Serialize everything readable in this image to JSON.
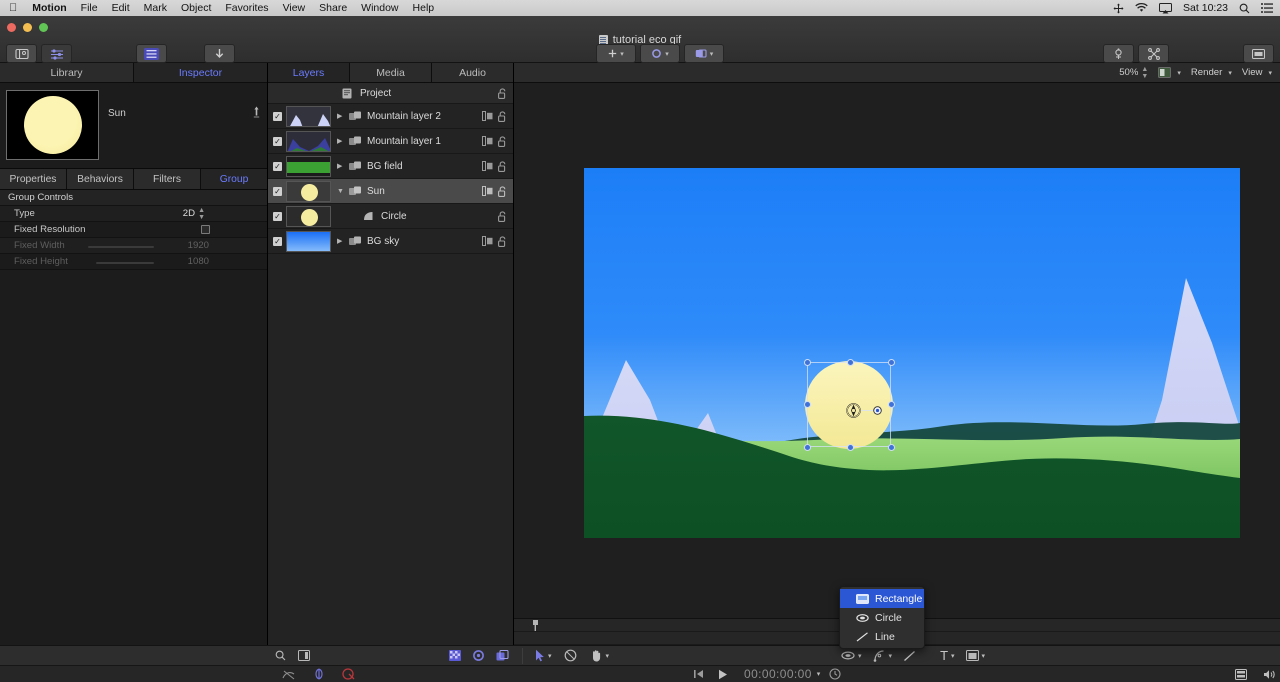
{
  "menubar": {
    "apple_icon": "apple-logo-icon",
    "items": [
      "Motion",
      "File",
      "Edit",
      "Mark",
      "Object",
      "Favorites",
      "View",
      "Share",
      "Window",
      "Help"
    ],
    "status_icons": [
      "move-icon",
      "wifi-icon",
      "airplay-icon"
    ],
    "clock": "Sat 10:23",
    "right_icons": [
      "search-icon",
      "control-center-icon"
    ]
  },
  "toolbar": {
    "document_title": "tutorial eco gif",
    "left_buttons": [
      {
        "label": "Library",
        "icon": "library-icon"
      },
      {
        "label": "Inspector",
        "icon": "inspector-sliders-icon"
      }
    ],
    "project_pane": {
      "label": "Project Pane",
      "icon": "project-pane-icon"
    },
    "import": {
      "label": "Import",
      "icon": "import-arrow-icon"
    },
    "center_buttons": [
      {
        "label": "Add Object",
        "icon": "plus-icon"
      },
      {
        "label": "Behaviors",
        "icon": "behaviors-gear-icon"
      },
      {
        "label": "Filters",
        "icon": "filters-icon"
      }
    ],
    "right_buttons": [
      {
        "label": "Make Particles",
        "icon": "particles-icon"
      },
      {
        "label": "Replicate",
        "icon": "replicate-icon"
      },
      {
        "label": "HUD",
        "icon": "hud-icon"
      }
    ]
  },
  "inspector": {
    "tabs": [
      {
        "label": "Library",
        "selected": false
      },
      {
        "label": "Inspector",
        "selected": true
      }
    ],
    "object_name": "Sun",
    "pin_icon": "pin-icon",
    "subtabs": [
      {
        "label": "Properties",
        "selected": false
      },
      {
        "label": "Behaviors",
        "selected": false
      },
      {
        "label": "Filters",
        "selected": false
      },
      {
        "label": "Group",
        "selected": true
      }
    ],
    "section_title": "Group Controls",
    "properties": [
      {
        "label": "Type",
        "value": "2D",
        "control": "stepper",
        "disabled": false
      },
      {
        "label": "Fixed Resolution",
        "value": "",
        "control": "checkbox",
        "disabled": false
      },
      {
        "label": "Fixed Width",
        "value": "1920",
        "control": "slider",
        "disabled": true
      },
      {
        "label": "Fixed Height",
        "value": "1080",
        "control": "slider",
        "disabled": true
      }
    ]
  },
  "layers": {
    "tabs": [
      {
        "label": "Layers",
        "selected": true
      },
      {
        "label": "Media",
        "selected": false
      },
      {
        "label": "Audio",
        "selected": false
      }
    ],
    "project_row": {
      "label": "Project",
      "icon": "document-icon",
      "lock_icon": "lock-open-icon"
    },
    "rows": [
      {
        "label": "Mountain layer 2",
        "checked": true,
        "type": "group",
        "expanded": false,
        "indent": 0,
        "thumb": "mountain2",
        "icons": [
          "dropzone-icon",
          "lock-open-icon"
        ]
      },
      {
        "label": "Mountain layer 1",
        "checked": true,
        "type": "group",
        "expanded": false,
        "indent": 0,
        "thumb": "mountain1",
        "icons": [
          "dropzone-icon",
          "lock-open-icon"
        ]
      },
      {
        "label": "BG field",
        "checked": true,
        "type": "group",
        "expanded": false,
        "indent": 0,
        "thumb": "field",
        "icons": [
          "dropzone-icon",
          "lock-open-icon"
        ]
      },
      {
        "label": "Sun",
        "checked": true,
        "type": "group",
        "expanded": true,
        "selected": true,
        "indent": 0,
        "thumb": "sun",
        "icons": [
          "dropzone-icon",
          "lock-open-icon"
        ]
      },
      {
        "label": "Circle",
        "checked": true,
        "type": "shape",
        "indent": 1,
        "thumb": "sun",
        "icons": [
          "lock-open-icon"
        ]
      },
      {
        "label": "BG sky",
        "checked": true,
        "type": "group",
        "expanded": false,
        "indent": 0,
        "thumb": "sky",
        "icons": [
          "dropzone-icon",
          "lock-open-icon"
        ]
      }
    ]
  },
  "canvas": {
    "zoom_level": "50%",
    "render_label": "Render",
    "view_label": "View",
    "channel_icon": "channel-swatch-icon",
    "selection": {
      "handles": 8,
      "anchor_icon": "anchor-point-icon",
      "rotation_icon": "rotation-handle-icon"
    },
    "colors": {
      "sky_top": "#1c7ef7",
      "sky_bottom": "#bcd9fb",
      "mountain": "#ccd2f5",
      "field_light": "#8fd06a",
      "field_dark": "#0e5c27",
      "sun": "#f7efa8"
    }
  },
  "shape_popup": {
    "items": [
      {
        "label": "Rectangle",
        "icon": "rectangle-icon",
        "highlighted": true
      },
      {
        "label": "Circle",
        "icon": "circle-icon",
        "highlighted": false
      },
      {
        "label": "Line",
        "icon": "line-icon",
        "highlighted": false
      }
    ]
  },
  "bottombar": {
    "left_icons": [
      "search-icon",
      "layout-icon"
    ],
    "view_icons": [
      "checkerboard-icon",
      "color-wheel-icon",
      "layers-toggle-icon"
    ],
    "tool_icons": [
      "select-arrow-icon",
      "transform-tool-icon",
      "pan-hand-icon"
    ],
    "shape_icons": [
      "mask-ellipse-icon",
      "bezier-pen-icon",
      "line-tool-icon",
      "text-tool-icon",
      "media-tool-icon"
    ],
    "right_icons": [
      "timeline-toggle-icon",
      "audio-speaker-icon"
    ]
  },
  "statusbar": {
    "left_icons": [
      "no-preview-icon",
      "loop-icon",
      "record-icon"
    ],
    "transport": [
      "go-to-start-icon",
      "play-icon"
    ],
    "timecode": "00:00:00:00",
    "timecode_caret": "chevron-down-icon",
    "clock_icon": "timecode-clock-icon"
  }
}
